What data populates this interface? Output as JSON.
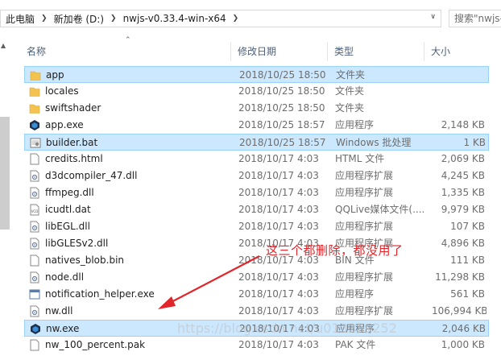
{
  "address": {
    "crumbs": [
      "此电脑",
      "新加卷 (D:)",
      "nwjs-v0.33.4-win-x64"
    ],
    "separator_icon": "chevron-right-icon",
    "search_placeholder": "搜索\"nwjs-..."
  },
  "columns": {
    "name": "名称",
    "date": "修改日期",
    "type": "类型",
    "size": "大小"
  },
  "files": [
    {
      "name": "app",
      "date": "2018/10/25 18:50",
      "type": "文件夹",
      "size": "",
      "icon": "folder-icon",
      "selected": true
    },
    {
      "name": "locales",
      "date": "2018/10/25 18:50",
      "type": "文件夹",
      "size": "",
      "icon": "folder-icon",
      "selected": false
    },
    {
      "name": "swiftshader",
      "date": "2018/10/25 18:50",
      "type": "文件夹",
      "size": "",
      "icon": "folder-icon",
      "selected": false
    },
    {
      "name": "app.exe",
      "date": "2018/10/25 18:57",
      "type": "应用程序",
      "size": "2,148 KB",
      "icon": "nwjs-exe-icon",
      "selected": false
    },
    {
      "name": "builder.bat",
      "date": "2018/10/25 18:57",
      "type": "Windows 批处理",
      "size": "1 KB",
      "icon": "batch-file-icon",
      "selected": true
    },
    {
      "name": "credits.html",
      "date": "2018/10/17 4:03",
      "type": "HTML 文件",
      "size": "2,069 KB",
      "icon": "html-file-icon",
      "selected": false
    },
    {
      "name": "d3dcompiler_47.dll",
      "date": "2018/10/17 4:03",
      "type": "应用程序扩展",
      "size": "4,245 KB",
      "icon": "dll-file-icon",
      "selected": false
    },
    {
      "name": "ffmpeg.dll",
      "date": "2018/10/17 4:03",
      "type": "应用程序扩展",
      "size": "1,335 KB",
      "icon": "dll-file-icon",
      "selected": false
    },
    {
      "name": "icudtl.dat",
      "date": "2018/10/17 4:03",
      "type": "QQLive媒体文件(....",
      "size": "9,979 KB",
      "icon": "dat-file-icon",
      "selected": false
    },
    {
      "name": "libEGL.dll",
      "date": "2018/10/17 4:03",
      "type": "应用程序扩展",
      "size": "107 KB",
      "icon": "dll-file-icon",
      "selected": false
    },
    {
      "name": "libGLESv2.dll",
      "date": "2018/10/17 4:03",
      "type": "应用程序扩展",
      "size": "4,896 KB",
      "icon": "dll-file-icon",
      "selected": false
    },
    {
      "name": "natives_blob.bin",
      "date": "2018/10/17 4:03",
      "type": "BIN 文件",
      "size": "111 KB",
      "icon": "bin-file-icon",
      "selected": false
    },
    {
      "name": "node.dll",
      "date": "2018/10/17 4:03",
      "type": "应用程序扩展",
      "size": "11,298 KB",
      "icon": "dll-file-icon",
      "selected": false
    },
    {
      "name": "notification_helper.exe",
      "date": "2018/10/17 4:03",
      "type": "应用程序",
      "size": "561 KB",
      "icon": "exe-file-icon",
      "selected": false
    },
    {
      "name": "nw.dll",
      "date": "2018/10/17 4:03",
      "type": "应用程序扩展",
      "size": "106,994 KB",
      "icon": "dll-file-icon",
      "selected": false
    },
    {
      "name": "nw.exe",
      "date": "2018/10/17 4:03",
      "type": "应用程序",
      "size": "2,046 KB",
      "icon": "nwjs-exe-icon",
      "selected": true
    },
    {
      "name": "nw_100_percent.pak",
      "date": "2018/10/17 4:03",
      "type": "PAK 文件",
      "size": "1,000 KB",
      "icon": "pak-file-icon",
      "selected": false
    }
  ],
  "annotation": {
    "text": "这三个都删除，都没用了",
    "color": "#e0262b"
  },
  "watermark": "https://blog.csdn.net/u013289252",
  "colors": {
    "selection_bg": "#cce8ff",
    "selection_border": "#99d1ff",
    "folder": "#f3c24f",
    "header_text": "#4c607a"
  }
}
